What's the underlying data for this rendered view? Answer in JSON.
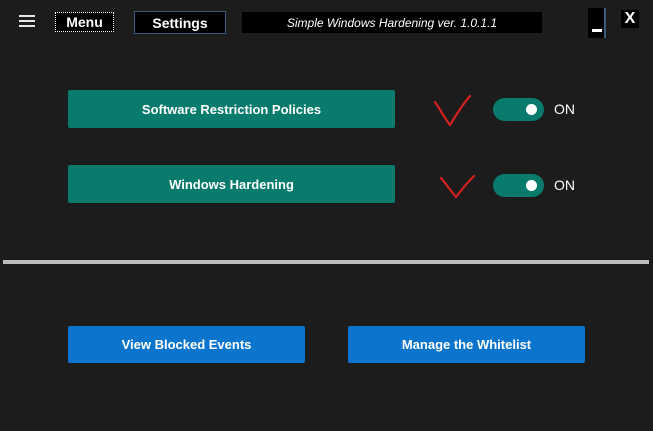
{
  "header": {
    "menu_label": "Menu",
    "settings_label": "Settings",
    "title": "Simple Windows Hardening ver. 1.0.1.1",
    "minimize_label": "",
    "close_label": "X"
  },
  "features": [
    {
      "label": "Software Restriction Policies",
      "state": "ON"
    },
    {
      "label": "Windows Hardening",
      "state": "ON"
    }
  ],
  "actions": {
    "view_blocked_events": "View Blocked Events",
    "manage_whitelist": "Manage the Whitelist"
  },
  "colors": {
    "background": "#1c1c1c",
    "teal": "#087b6c",
    "blue": "#0b74cc",
    "check_annotation": "#d42020"
  },
  "icons": {
    "menu": "hamburger-icon",
    "check": "checkmark-icon"
  }
}
